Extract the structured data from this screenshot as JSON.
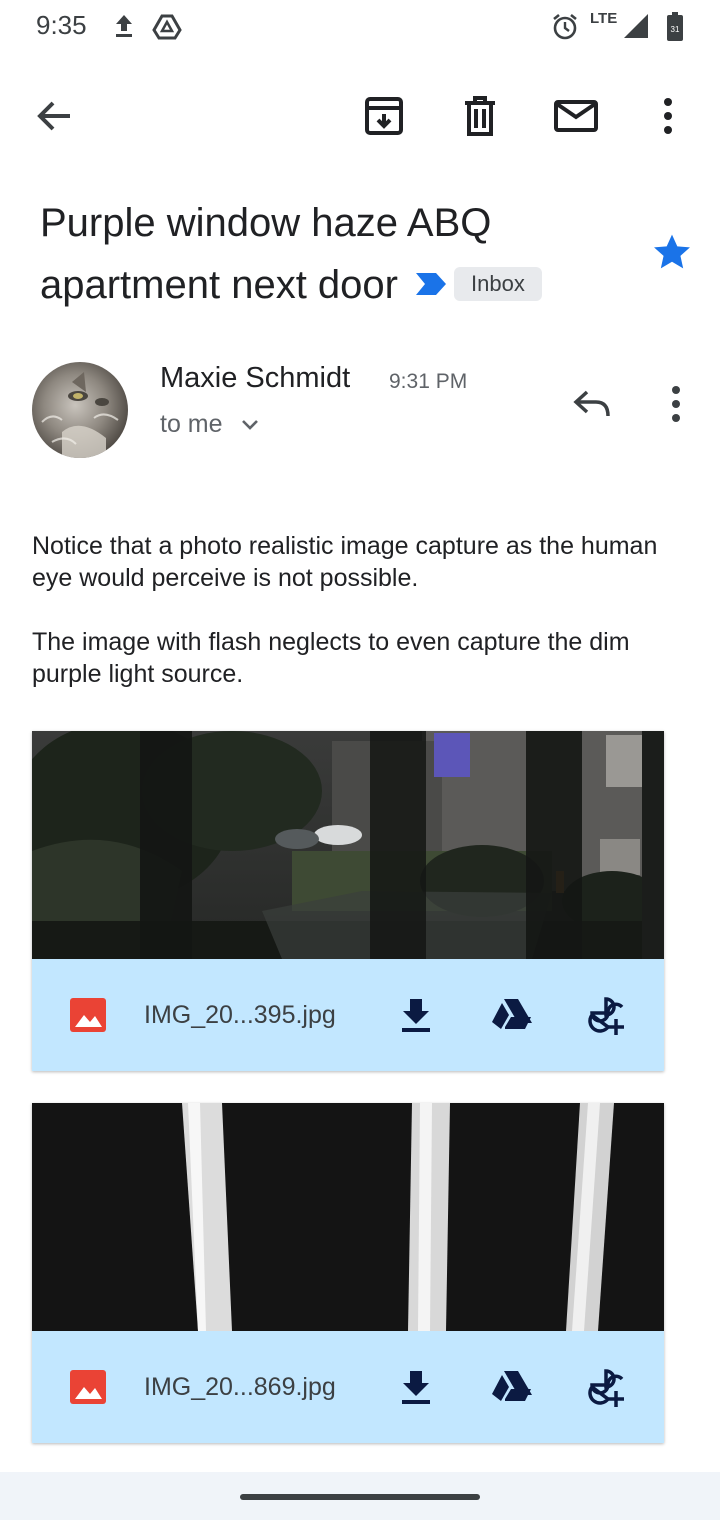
{
  "status_bar": {
    "time": "9:35",
    "network": "LTE",
    "icons": [
      "upload-icon",
      "drive-icon",
      "alarm-icon",
      "signal-icon",
      "battery-icon"
    ]
  },
  "toolbar": {
    "icons": [
      "back-arrow-icon",
      "archive-icon",
      "delete-icon",
      "mark-unread-icon",
      "more-vert-icon"
    ]
  },
  "email": {
    "subject": "Purple window haze ABQ apartment next door",
    "label": "Inbox",
    "starred": true,
    "sender": "Maxie Schmidt",
    "time": "9:31 PM",
    "recipient": "to me",
    "body": [
      "Notice that a photo realistic image capture as the human eye would perceive is not possible.",
      "The image with flash neglects to even capture the dim purple light source."
    ]
  },
  "attachments": [
    {
      "name": "IMG_20...395.jpg"
    },
    {
      "name": "IMG_20...869.jpg"
    }
  ],
  "colors": {
    "accent_blue": "#1a73e8",
    "attachment_bar": "#c2e7ff",
    "image_icon_red": "#ea4335",
    "chip_bg": "#e8eaed"
  }
}
